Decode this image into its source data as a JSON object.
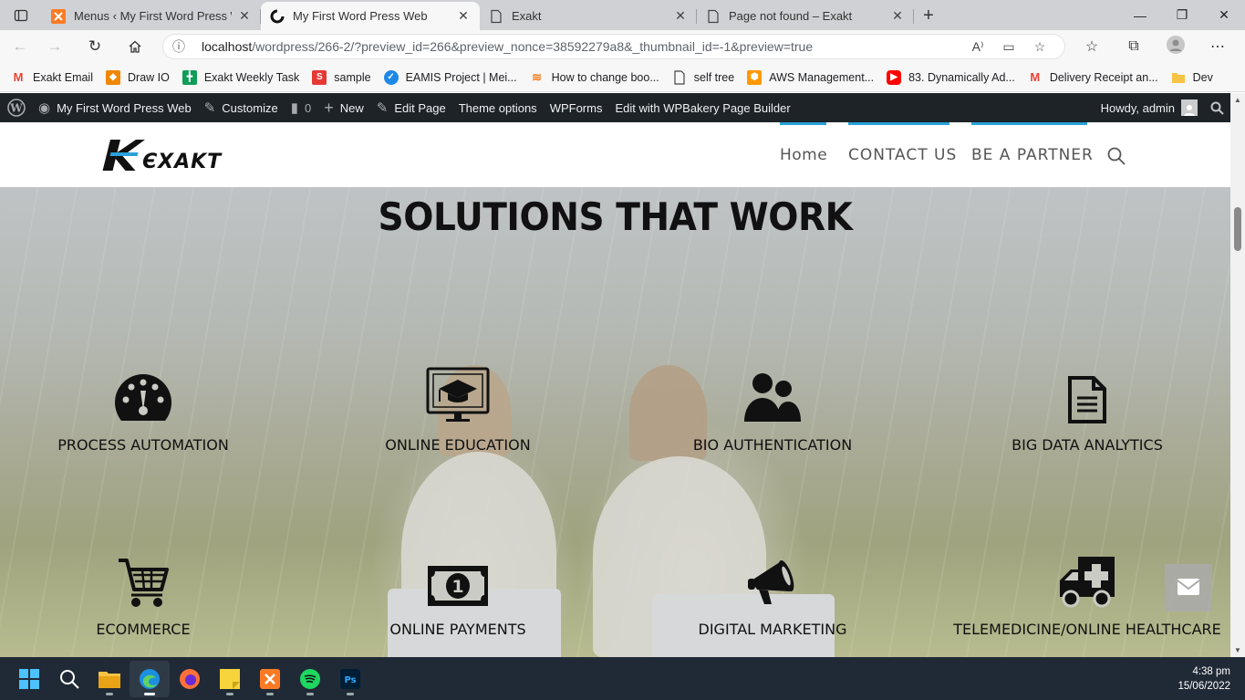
{
  "tabs": [
    {
      "title": "Menus ‹ My First Word Press We",
      "favicon": "xampp-icon"
    },
    {
      "title": "My First Word Press Web",
      "favicon": "wp-loader-icon",
      "active": true
    },
    {
      "title": "Exakt",
      "favicon": "page-icon"
    },
    {
      "title": "Page not found – Exakt",
      "favicon": "page-icon"
    }
  ],
  "address": {
    "url_host": "localhost",
    "url_path": "/wordpress/266-2/?preview_id=266&preview_nonce=38592279a8&_thumbnail_id=-1&preview=true"
  },
  "bookmarks": [
    {
      "label": "Exakt Email",
      "icon": "gmail-icon",
      "color": "#ea4335"
    },
    {
      "label": "Draw IO",
      "icon": "drawio-icon",
      "color": "#f08705"
    },
    {
      "label": "Exakt Weekly Task",
      "icon": "sheets-icon",
      "color": "#0f9d58"
    },
    {
      "label": "sample",
      "icon": "s-icon",
      "color": "#e53935"
    },
    {
      "label": "EAMIS Project | Mei...",
      "icon": "check-icon",
      "color": "#1e88e5"
    },
    {
      "label": "How to change boo...",
      "icon": "stackoverflow-icon",
      "color": "#f48024"
    },
    {
      "label": "self tree",
      "icon": "page-icon",
      "color": "#555555"
    },
    {
      "label": "AWS Management...",
      "icon": "aws-icon",
      "color": "#ff9900"
    },
    {
      "label": "83. Dynamically Ad...",
      "icon": "youtube-icon",
      "color": "#ff0000"
    },
    {
      "label": "Delivery Receipt an...",
      "icon": "gmail-icon",
      "color": "#ea4335"
    },
    {
      "label": "Dev",
      "icon": "folder-icon",
      "color": "#f6c343"
    }
  ],
  "wpbar": {
    "site": "My First Word Press Web",
    "customize": "Customize",
    "comments": "0",
    "new": "New",
    "edit_page": "Edit Page",
    "theme_options": "Theme options",
    "wpforms": "WPForms",
    "wpbakery": "Edit with WPBakery Page Builder",
    "howdy": "Howdy, admin"
  },
  "site": {
    "logo_text": "Kexakt",
    "menu": [
      "Home",
      "CONTACT US",
      "BE A PARTNER"
    ],
    "hero_title": "SOLUTIONS THAT WORK",
    "services": [
      {
        "label": "PROCESS AUTOMATION",
        "icon": "dashboard-icon"
      },
      {
        "label": "ONLINE EDUCATION",
        "icon": "graduation-monitor-icon"
      },
      {
        "label": "BIO AUTHENTICATION",
        "icon": "users-icon"
      },
      {
        "label": "BIG DATA ANALYTICS",
        "icon": "document-icon"
      },
      {
        "label": "ECOMMERCE",
        "icon": "cart-icon"
      },
      {
        "label": "ONLINE PAYMENTS",
        "icon": "banknote-icon"
      },
      {
        "label": "DIGITAL MARKETING",
        "icon": "megaphone-icon"
      },
      {
        "label": "TELEMEDICINE/ONLINE HEALTHCARE",
        "icon": "ambulance-icon"
      }
    ]
  },
  "clock": {
    "time": "4:38 pm",
    "date": "15/06/2022"
  },
  "colors": {
    "wpbar": "#1d2327",
    "accent": "#2aa1d9",
    "taskbar": "#202a36"
  }
}
